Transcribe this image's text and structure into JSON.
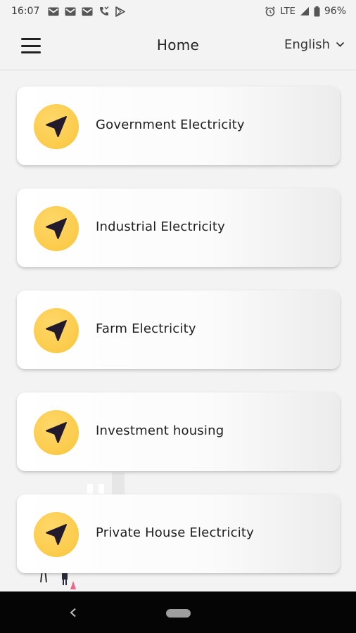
{
  "status_bar": {
    "time": "16:07",
    "network": "LTE",
    "battery": "96%",
    "left_icons": [
      "gmail-icon",
      "gmail-icon",
      "gmail-icon",
      "missed-call-icon",
      "play-store-icon"
    ],
    "right_icons": [
      "alarm-icon",
      "signal-icon",
      "battery-icon"
    ]
  },
  "header": {
    "title": "Home",
    "language": "English"
  },
  "cards": [
    {
      "label": "Government Electricity",
      "icon": "send-icon"
    },
    {
      "label": "Industrial Electricity",
      "icon": "send-icon"
    },
    {
      "label": "Farm Electricity",
      "icon": "send-icon"
    },
    {
      "label": "Investment housing",
      "icon": "send-icon"
    },
    {
      "label": "Private House Electricity",
      "icon": "send-icon"
    }
  ],
  "colors": {
    "background": "#f3f3f3",
    "icon_circle": "#fbcb4a",
    "icon_glyph": "#231a2e",
    "nav_bar": "#050505"
  }
}
